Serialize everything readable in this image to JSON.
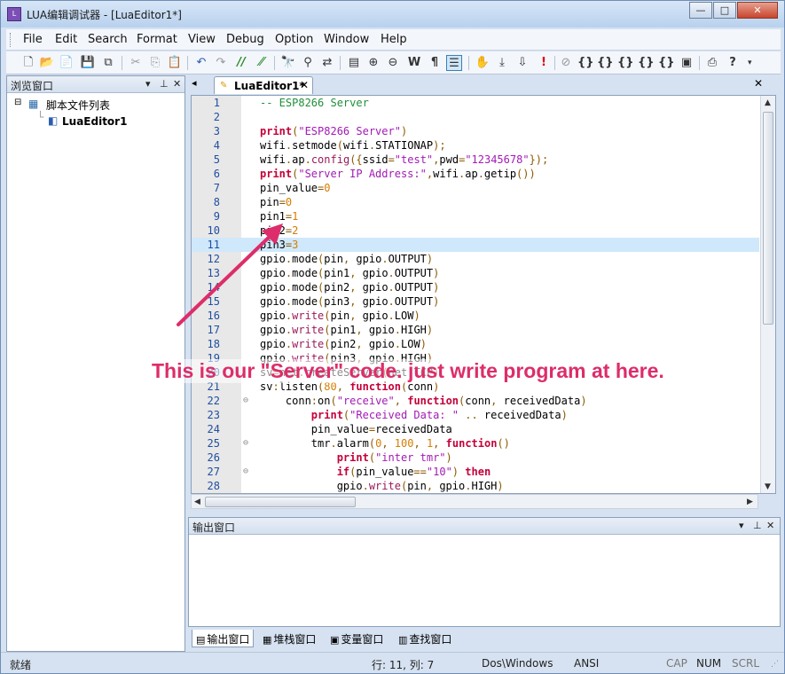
{
  "window": {
    "title": "LUA编辑调试器 - [LuaEditor1*]",
    "controls": {
      "minimize": "—",
      "maximize": "□",
      "close": "✕"
    }
  },
  "menu": [
    "File",
    "Edit",
    "Search",
    "Format",
    "View",
    "Debug",
    "Option",
    "Window",
    "Help"
  ],
  "toolbar_icons": [
    "new-file-icon",
    "open-folder-icon",
    "open-file-icon",
    "save-icon",
    "save-all-icon",
    "cut-icon",
    "copy-icon",
    "paste-icon",
    "undo-icon",
    "redo-icon",
    "comment-icon",
    "uncomment-icon",
    "find-icon",
    "find-next-icon",
    "replace-icon",
    "bookmark-icon",
    "zoom-in-icon",
    "zoom-out-icon",
    "word-wrap-icon",
    "paragraph-icon",
    "indent-guide-icon",
    "hand-icon",
    "step-icon",
    "run-icon",
    "breakpoint-icon",
    "stop-icon",
    "brace-icon-1",
    "brace-icon-2",
    "brace-icon-3",
    "brace-icon-4",
    "brace-icon-5",
    "screenshot-icon",
    "print-icon",
    "help-icon"
  ],
  "left_panel": {
    "title": "浏览窗口",
    "tree": {
      "root": "脚本文件列表",
      "child": "LuaEditor1"
    }
  },
  "editor": {
    "tab_label": "LuaEditor1*",
    "highlight_line": 11,
    "lines": [
      {
        "n": "1",
        "fold": "",
        "code": "-- ESP8266 Server"
      },
      {
        "n": "2",
        "fold": "",
        "code": ""
      },
      {
        "n": "3",
        "fold": "",
        "code": "print(\"ESP8266 Server\")"
      },
      {
        "n": "4",
        "fold": "",
        "code": "wifi.setmode(wifi.STATIONAP);"
      },
      {
        "n": "5",
        "fold": "",
        "code": "wifi.ap.config({ssid=\"test\",pwd=\"12345678\"});"
      },
      {
        "n": "6",
        "fold": "",
        "code": "print(\"Server IP Address:\",wifi.ap.getip())"
      },
      {
        "n": "7",
        "fold": "",
        "code": "pin_value=0"
      },
      {
        "n": "8",
        "fold": "",
        "code": "pin=0"
      },
      {
        "n": "9",
        "fold": "",
        "code": "pin1=1"
      },
      {
        "n": "10",
        "fold": "",
        "code": "pin2=2"
      },
      {
        "n": "11",
        "fold": "",
        "code": "pin3=3"
      },
      {
        "n": "12",
        "fold": "",
        "code": "gpio.mode(pin, gpio.OUTPUT)"
      },
      {
        "n": "13",
        "fold": "",
        "code": "gpio.mode(pin1, gpio.OUTPUT)"
      },
      {
        "n": "14",
        "fold": "",
        "code": "gpio.mode(pin2, gpio.OUTPUT)"
      },
      {
        "n": "15",
        "fold": "",
        "code": "gpio.mode(pin3, gpio.OUTPUT)"
      },
      {
        "n": "16",
        "fold": "",
        "code": "gpio.write(pin, gpio.LOW)"
      },
      {
        "n": "17",
        "fold": "",
        "code": "gpio.write(pin1, gpio.HIGH)"
      },
      {
        "n": "18",
        "fold": "",
        "code": "gpio.write(pin2, gpio.LOW)"
      },
      {
        "n": "19",
        "fold": "",
        "code": "gpio.write(pin3, gpio.HIGH)"
      },
      {
        "n": "20",
        "fold": "",
        "code": "sv=net.createServer(net.TCP)"
      },
      {
        "n": "21",
        "fold": "",
        "code": "sv:listen(80, function(conn)"
      },
      {
        "n": "22",
        "fold": "⊖",
        "code": "    conn:on(\"receive\", function(conn, receivedData)"
      },
      {
        "n": "23",
        "fold": "",
        "code": "        print(\"Received Data: \" .. receivedData)"
      },
      {
        "n": "24",
        "fold": "",
        "code": "        pin_value=receivedData"
      },
      {
        "n": "25",
        "fold": "⊖",
        "code": "        tmr.alarm(0, 100, 1, function()"
      },
      {
        "n": "26",
        "fold": "",
        "code": "            print(\"inter tmr\")"
      },
      {
        "n": "27",
        "fold": "⊖",
        "code": "            if(pin_value==\"10\") then"
      },
      {
        "n": "28",
        "fold": "",
        "code": "            gpio.write(pin, gpio.HIGH)"
      }
    ]
  },
  "output_panel": {
    "title": "输出窗口"
  },
  "bottom_tabs": [
    {
      "label": "输出窗口",
      "icon": "output-window-icon"
    },
    {
      "label": "堆栈窗口",
      "icon": "stack-window-icon"
    },
    {
      "label": "变量窗口",
      "icon": "variable-window-icon"
    },
    {
      "label": "查找窗口",
      "icon": "find-window-icon"
    }
  ],
  "status": {
    "ready": "就绪",
    "position": "行: 11, 列: 7",
    "line_ending": "Dos\\Windows",
    "encoding": "ANSI",
    "cap": "CAP",
    "num": "NUM",
    "scrl": "SCRL"
  },
  "annotation": {
    "text": "This is our \"Server\" code. just write program at here.",
    "color": "#dd2d6a"
  },
  "colors": {
    "keyword": "#c4003a",
    "string": "#a21ab5",
    "number": "#d67c00",
    "comment": "#1f8f3a",
    "line_highlight": "#cfe8fb"
  }
}
